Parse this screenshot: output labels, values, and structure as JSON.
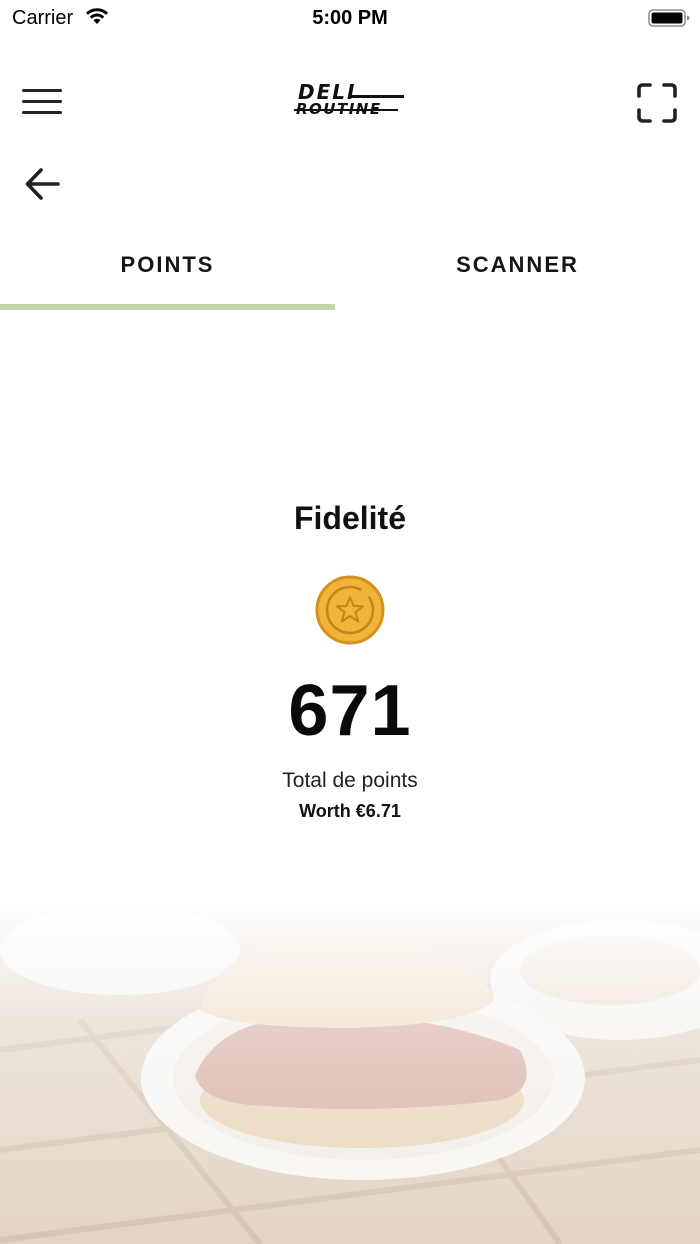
{
  "status_bar": {
    "carrier": "Carrier",
    "time": "5:00 PM"
  },
  "header": {
    "logo_line1": "DELI",
    "logo_line2": "ROUTINE",
    "menu_icon": "hamburger-menu-icon",
    "scan_icon": "scan-frame-icon"
  },
  "nav": {
    "back_icon": "arrow-left-icon"
  },
  "tabs": [
    {
      "label": "POINTS",
      "active": true
    },
    {
      "label": "SCANNER",
      "active": false
    }
  ],
  "loyalty": {
    "title": "Fidelité",
    "icon": "star-coin-icon",
    "points": "671",
    "points_label": "Total de points",
    "worth": "Worth €6.71"
  },
  "colors": {
    "tab_indicator": "#c3d6ab",
    "coin_fill": "#f0b43a",
    "coin_border": "#d4921c"
  }
}
